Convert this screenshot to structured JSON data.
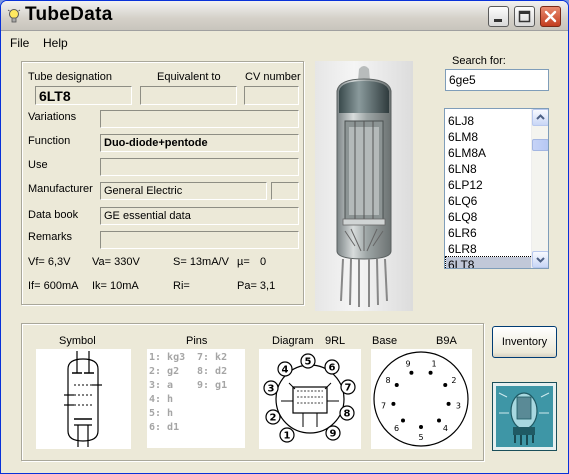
{
  "window": {
    "title": "TubeData",
    "accent": "#0831d9"
  },
  "menu": {
    "file": "File",
    "help": "Help"
  },
  "headers": {
    "designation": "Tube designation",
    "equivalent": "Equivalent to",
    "cv": "CV number"
  },
  "tube": {
    "designation": "6LT8",
    "equivalent": "",
    "cv": "",
    "variations": "",
    "function": "Duo-diode+pentode",
    "use": "",
    "manufacturer": "General Electric",
    "manufacturer_extra": "",
    "databook": "GE essential data",
    "remarks": ""
  },
  "labels": {
    "variations": "Variations",
    "function": "Function",
    "use": "Use",
    "manufacturer": "Manufacturer",
    "databook": "Data book",
    "remarks": "Remarks"
  },
  "specs": {
    "vf": "Vf= 6,3V",
    "va": "Va= 330V",
    "s": "S= 13mA/V",
    "mu": "µ=",
    "mu_val": "0",
    "if": "If= 600mA",
    "ik": "Ik= 10mA",
    "ri": "Ri=",
    "pa": "Pa= 3,1"
  },
  "search": {
    "label": "Search for:",
    "value": "6ge5"
  },
  "list": {
    "items": [
      "6LJ8",
      "6LM8",
      "6LM8A",
      "6LN8",
      "6LP12",
      "6LQ6",
      "6LQ8",
      "6LR6",
      "6LR8",
      "6LT8"
    ],
    "selected": "6LT8"
  },
  "bottom": {
    "symbol": "Symbol",
    "pins": "Pins",
    "diagram": "Diagram",
    "diagram_code": "9RL",
    "base": "Base",
    "base_code": "B9A"
  },
  "pins": [
    "1: kg3",
    "2: g2",
    "3: a",
    "4: h",
    "5: h",
    "6: d1",
    "7: k2",
    "8: d2",
    "9: g1"
  ],
  "diagram_pins": [
    "1",
    "2",
    "3",
    "4",
    "5",
    "6",
    "7",
    "8",
    "9"
  ],
  "inventory": "Inventory",
  "icons": {
    "app": "lightbulb-icon",
    "min": "minimize-icon",
    "max": "maximize-icon",
    "close": "close-icon"
  }
}
